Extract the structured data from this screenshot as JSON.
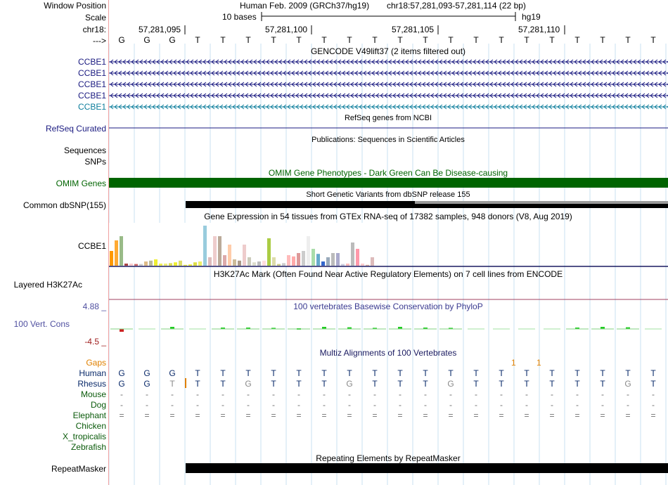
{
  "labels": {
    "window_position": "Window Position",
    "scale": "Scale",
    "chrom": "chr18:",
    "arrow": "--->",
    "gencode_rows": [
      "CCBE1",
      "CCBE1",
      "CCBE1",
      "CCBE1",
      "CCBE1"
    ],
    "refseq_curated": "RefSeq Curated",
    "sequences": "Sequences",
    "snps": "SNPs",
    "omim_genes": "OMIM Genes",
    "common_dbsnp": "Common dbSNP(155)",
    "gtex_gene": "CCBE1",
    "layered_h3k27ac": "Layered H3K27Ac",
    "cons_top": "4.88 _",
    "cons_label": "100 Vert. Cons",
    "cons_bottom": "-4.5 _",
    "gaps": "Gaps",
    "species": [
      "Human",
      "Rhesus",
      "Mouse",
      "Dog",
      "Elephant",
      "Chicken",
      "X_tropicalis",
      "Zebrafish"
    ],
    "repeatmasker": "RepeatMasker"
  },
  "header": {
    "assembly": "Human Feb. 2009 (GRCh37/hg19)",
    "position": "chr18:57,281,093-57,281,114 (22 bp)",
    "scale_text": "10 bases",
    "scale_db": "hg19",
    "ticks": [
      "57,281,095",
      "57,281,100",
      "57,281,105",
      "57,281,110"
    ]
  },
  "bases": [
    "G",
    "G",
    "G",
    "T",
    "T",
    "T",
    "T",
    "T",
    "T",
    "T",
    "T",
    "T",
    "T",
    "T",
    "T",
    "T",
    "T",
    "T",
    "T",
    "T",
    "T",
    "T"
  ],
  "track_titles": {
    "gencode": "GENCODE V49lift37 (2 items filtered out)",
    "refseq": "RefSeq genes from NCBI",
    "publications": "Publications: Sequences in Scientific Articles",
    "omim": "OMIM Gene Phenotypes - Dark Green Can Be Disease-causing",
    "dbsnp": "Short Genetic Variants from dbSNP release 155",
    "gtex": "Gene Expression in 54 tissues from GTEx RNA-seq of 17382 samples, 948 donors (V8, Aug 2019)",
    "h3k27ac": "H3K27Ac Mark (Often Found Near Active Regulatory Elements) on 7 cell lines from ENCODE",
    "phylop": "100 vertebrates Basewise Conservation by PhyloP",
    "multiz": "Multiz Alignments of 100 Vertebrates",
    "repeatmasker": "Repeating Elements by RepeatMasker"
  },
  "gaps_marks": [
    "1",
    "1"
  ],
  "alignment": {
    "Human": [
      "G",
      "G",
      "G",
      "T",
      "T",
      "T",
      "T",
      "T",
      "T",
      "T",
      "T",
      "T",
      "T",
      "T",
      "T",
      "T",
      "T",
      "T",
      "T",
      "T",
      "T",
      "T"
    ],
    "Rhesus": [
      "G",
      "G",
      "T",
      "T",
      "T",
      "G",
      "T",
      "T",
      "T",
      "G",
      "T",
      "T",
      "T",
      "G",
      "T",
      "T",
      "T",
      "T",
      "T",
      "T",
      "G",
      "T"
    ],
    "Mouse": [
      "-",
      "-",
      "-",
      "-",
      "-",
      "-",
      "-",
      "-",
      "-",
      "-",
      "-",
      "-",
      "-",
      "-",
      "-",
      "-",
      "-",
      "-",
      "-",
      "-",
      "-",
      "-"
    ],
    "Dog": [
      "-",
      "-",
      "-",
      "-",
      "-",
      "-",
      "-",
      "-",
      "-",
      "-",
      "-",
      "-",
      "-",
      "-",
      "-",
      "-",
      "-",
      "-",
      "-",
      "-",
      "-",
      "-"
    ],
    "Elephant": [
      "=",
      "=",
      "=",
      "=",
      "=",
      "=",
      "=",
      "=",
      "=",
      "=",
      "=",
      "=",
      "=",
      "=",
      "=",
      "=",
      "=",
      "=",
      "=",
      "=",
      "=",
      "="
    ]
  },
  "colors": {
    "gencode": "#1a1a80",
    "gencode_last": "#0e7e9c",
    "omim": "#006400",
    "cons": "#5050a0",
    "cons_neg": "#a02020",
    "gaps": "#e08000",
    "species": "#0a5a0a",
    "grid": "#c8e0f0",
    "link": "#ff8080"
  },
  "gtex_values": [
    0.35,
    0.6,
    0.7,
    0.05,
    0.05,
    0.04,
    0.04,
    0.1,
    0.12,
    0.15,
    0.05,
    0.05,
    0.06,
    0.08,
    0.12,
    0.02,
    0.03,
    0.08,
    0.1,
    0.95,
    0.2,
    0.7,
    0.7,
    0.25,
    0.5,
    0.15,
    0.12,
    0.5,
    0.2,
    0.08,
    0.1,
    0.12,
    0.65,
    0.2,
    0.04,
    0.06,
    0.25,
    0.22,
    0.3,
    0.35,
    0.7,
    0.4,
    0.28,
    0.1,
    0.2,
    0.3,
    0.3,
    0.04,
    0.05,
    0.55,
    0.4,
    0.05,
    0.02,
    0.2
  ],
  "gtex_colors": [
    "#ff9900",
    "#ffaa33",
    "#99bb88",
    "#aa4444",
    "#ffcccc",
    "#cc6666",
    "#cccccc",
    "#ddbb88",
    "#bbbb99",
    "#eeee33",
    "#eeee55",
    "#eeee77",
    "#dddd55",
    "#eeee33",
    "#dddd66",
    "#eeee33",
    "#eeee33",
    "#dddd44",
    "#eeee66",
    "#99ccdd",
    "#ddbbbb",
    "#eecccc",
    "#bbaa99",
    "#ddaaaa",
    "#ffccaa",
    "#ccbb99",
    "#aa9988",
    "#eecccc",
    "#ccccbb",
    "#ddddcc",
    "#bbbbbb",
    "#ffdddd",
    "#aacc44",
    "#ddddaa",
    "#cccc88",
    "#cccccc",
    "#ffbbbb",
    "#ffaaaa",
    "#dd9999",
    "#cccccc",
    "#eeeeee",
    "#aaddaa",
    "#66aacc",
    "#3366cc",
    "#99aabb",
    "#bbbbbb",
    "#aaaacc",
    "#ccccdd",
    "#ffbbbb",
    "#bbbbbb",
    "#ff99aa",
    "#ffcccc",
    "#ddaa99",
    "#ddbbbb"
  ],
  "phylop_values": [
    -0.2,
    0,
    0.15,
    0,
    0.1,
    0.1,
    0.08,
    0.05,
    0.15,
    0.12,
    0.08,
    0.15,
    0.1,
    0.08,
    0,
    0,
    0,
    0,
    0.1,
    0.15,
    0.12,
    0
  ]
}
